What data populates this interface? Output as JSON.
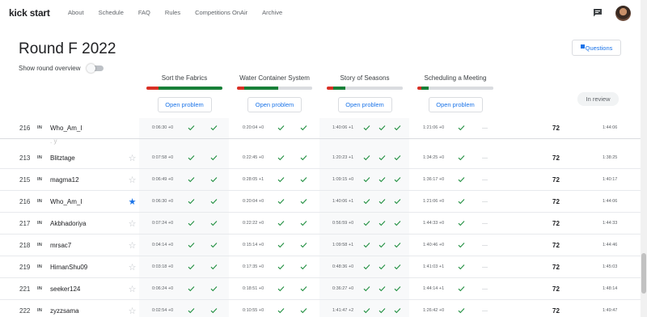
{
  "nav": {
    "logo": "kick start",
    "links": [
      "About",
      "Schedule",
      "FAQ",
      "Rules",
      "Competitions OnAir",
      "Archive"
    ]
  },
  "page": {
    "title": "Round F 2022",
    "overview_label": "Show round overview",
    "questions_label": "Questions",
    "review_label": "In review"
  },
  "problems": [
    {
      "title": "Sort the Fabrics",
      "button": "Open problem",
      "bar": {
        "red": 0.16,
        "green": 0.84
      }
    },
    {
      "title": "Water Container System",
      "button": "Open problem",
      "bar": {
        "red": 0.1,
        "green": 0.45,
        "grey": 0.45
      }
    },
    {
      "title": "Story of Seasons",
      "button": "Open problem",
      "bar": {
        "red": 0.08,
        "green": 0.16,
        "grey": 0.76
      }
    },
    {
      "title": "Scheduling a Meeting",
      "button": "Open problem",
      "bar": {
        "red": 0.05,
        "green": 0.1,
        "grey": 0.85
      }
    }
  ],
  "colors": {
    "accent": "#1a73e8",
    "check": "#1e8e3e",
    "red": "#d93025",
    "green": "#188038",
    "grey": "#dadce0"
  },
  "pinned_row": {
    "rank": "216",
    "flag": "IN",
    "name": "Who_Am_I",
    "score": "72",
    "penalty": "1:44:06",
    "times": [
      "0:06:30 +0",
      "0:20:04 +0",
      "1:40:06 +1",
      "1:21:06 +0"
    ]
  },
  "rows": [
    {
      "rank": "213",
      "flag": "IN",
      "name": "Blitztage",
      "starred": false,
      "score": "72",
      "penalty": "1:38:25",
      "times": [
        "0:07:58 +0",
        "0:22:45 +0",
        "1:20:23 +1",
        "1:34:25 +0"
      ]
    },
    {
      "rank": "215",
      "flag": "IN",
      "name": "magma12",
      "starred": false,
      "score": "72",
      "penalty": "1:40:17",
      "times": [
        "0:06:49 +0",
        "0:28:05 +1",
        "1:09:15 +0",
        "1:36:17 +0"
      ]
    },
    {
      "rank": "216",
      "flag": "IN",
      "name": "Who_Am_I",
      "starred": true,
      "score": "72",
      "penalty": "1:44:06",
      "times": [
        "0:06:30 +0",
        "0:20:04 +0",
        "1:40:06 +1",
        "1:21:06 +0"
      ]
    },
    {
      "rank": "217",
      "flag": "IN",
      "name": "Akbhadoriya",
      "starred": false,
      "score": "72",
      "penalty": "1:44:33",
      "times": [
        "0:07:24 +0",
        "0:22:22 +0",
        "0:56:59 +0",
        "1:44:33 +0"
      ]
    },
    {
      "rank": "218",
      "flag": "IN",
      "name": "mrsac7",
      "starred": false,
      "score": "72",
      "penalty": "1:44:46",
      "times": [
        "0:04:14 +0",
        "0:15:14 +0",
        "1:09:58 +1",
        "1:40:46 +0"
      ]
    },
    {
      "rank": "219",
      "flag": "IN",
      "name": "HimanShu09",
      "starred": false,
      "score": "72",
      "penalty": "1:45:03",
      "times": [
        "0:03:18 +0",
        "0:17:35 +0",
        "0:48:36 +0",
        "1:41:03 +1"
      ]
    },
    {
      "rank": "221",
      "flag": "IN",
      "name": "seeker124",
      "starred": false,
      "score": "72",
      "penalty": "1:48:14",
      "times": [
        "0:06:24 +0",
        "0:18:51 +0",
        "0:36:27 +0",
        "1:44:14 +1"
      ]
    },
    {
      "rank": "222",
      "flag": "IN",
      "name": "zyzzsama",
      "starred": false,
      "score": "72",
      "penalty": "1:49:47",
      "times": [
        "0:02:54 +0",
        "0:10:55 +0",
        "1:41:47 +2",
        "1:26:42 +0"
      ]
    }
  ]
}
